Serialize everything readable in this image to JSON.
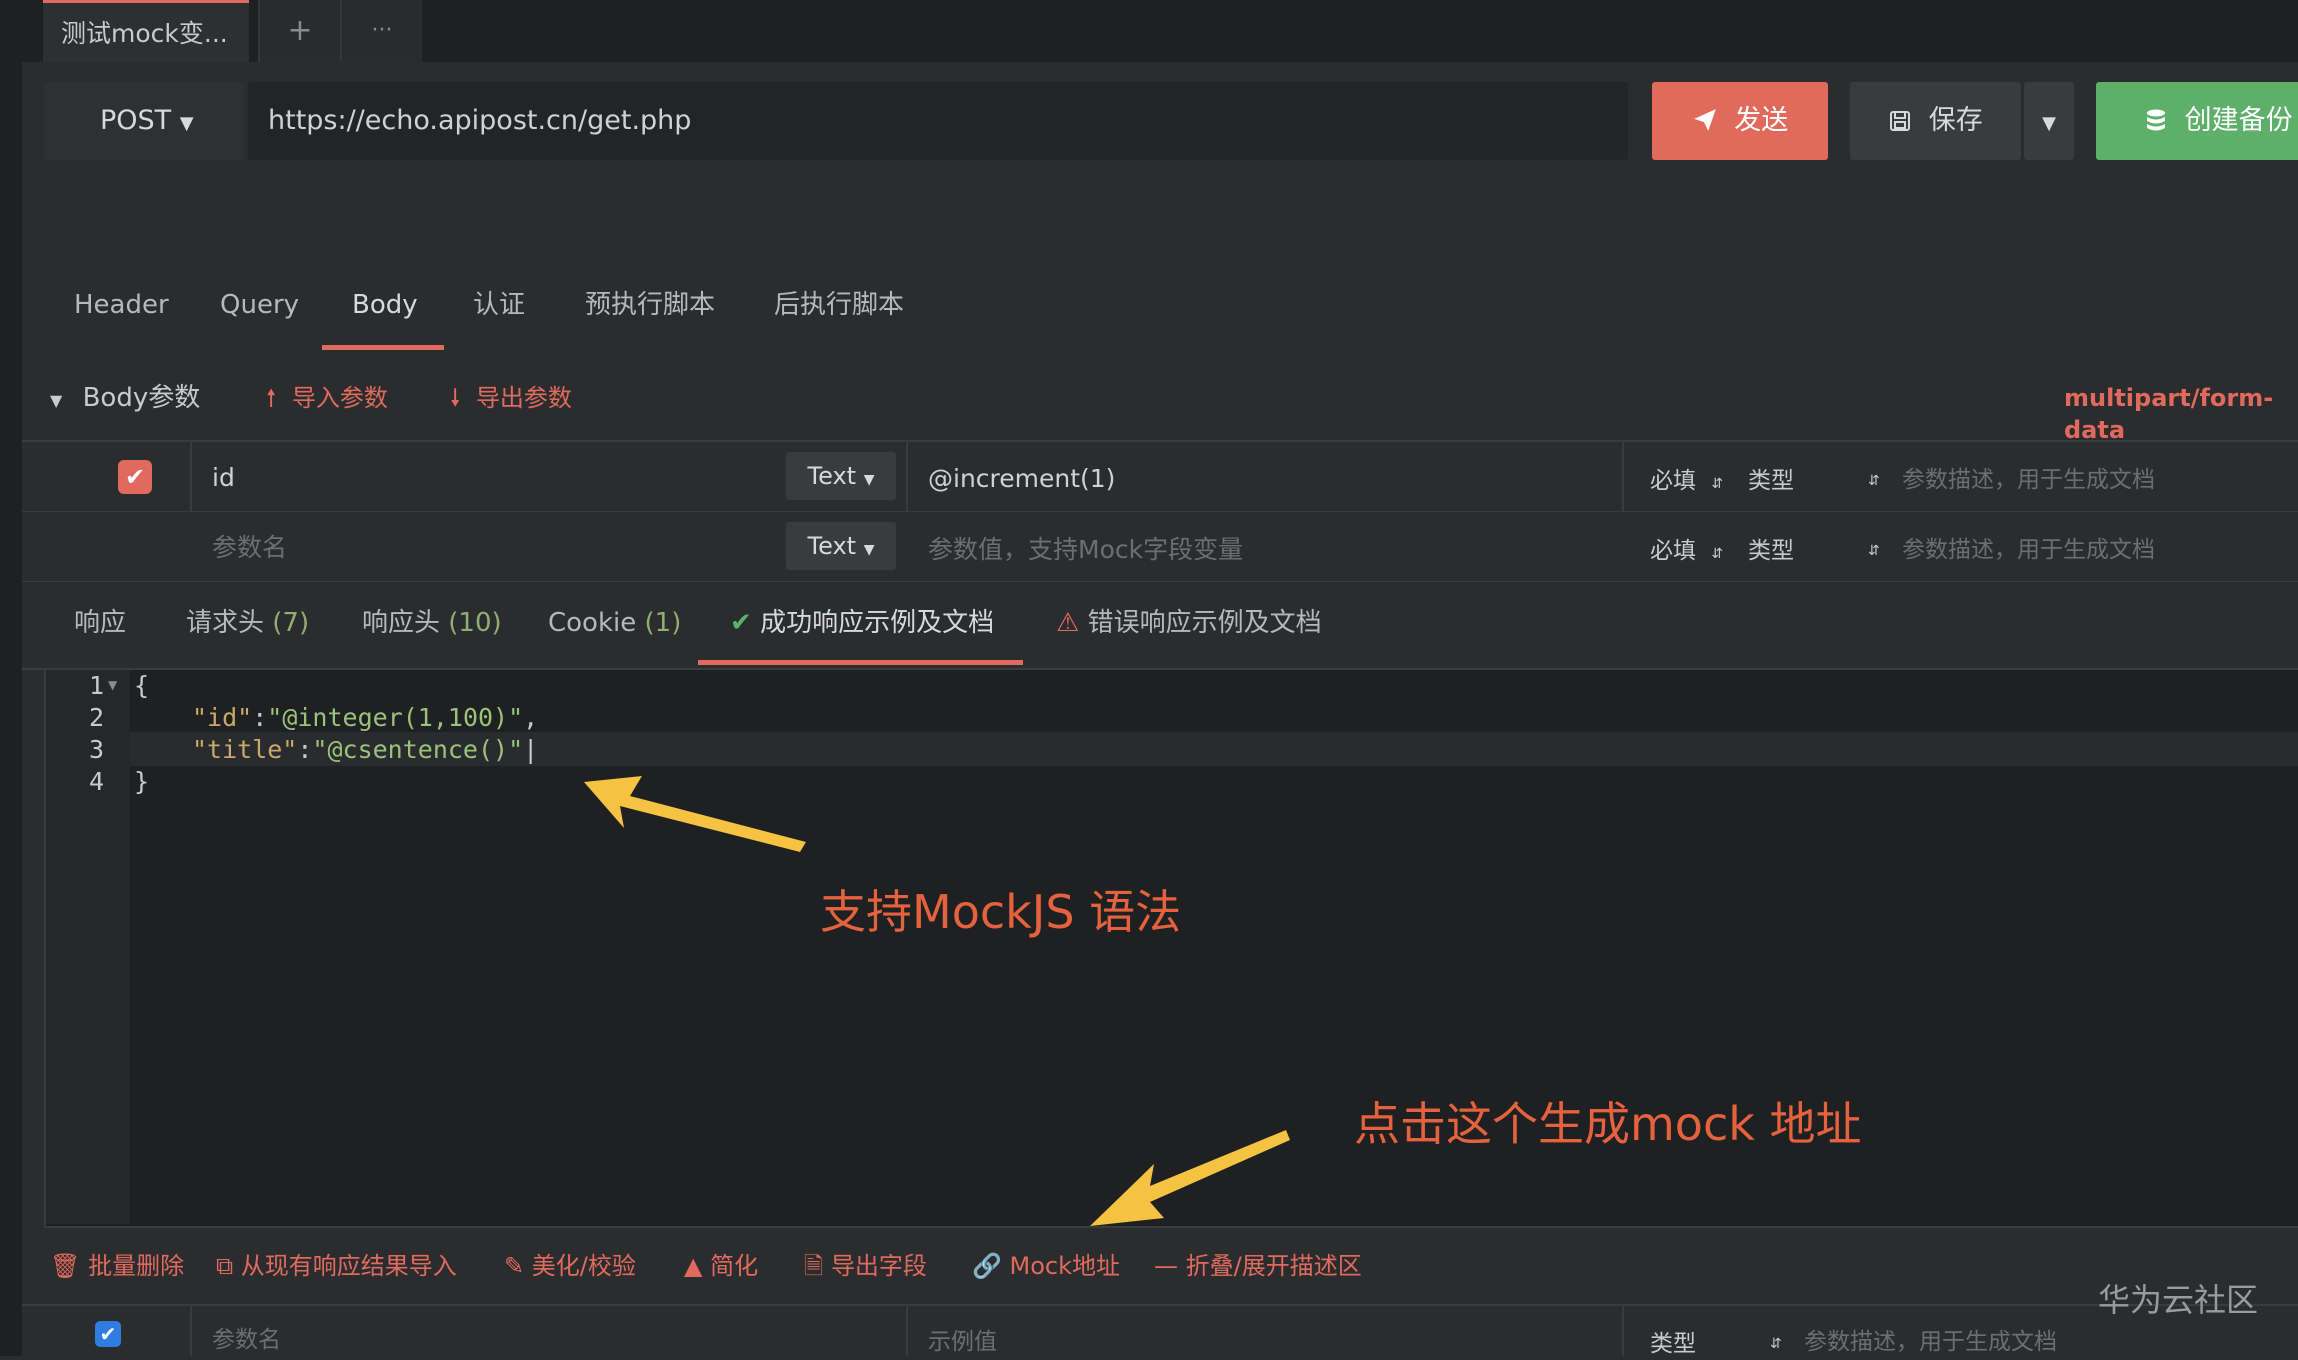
{
  "tab": {
    "title": "测试mock变...",
    "add_label": "+",
    "more_label": "···"
  },
  "request": {
    "method": "POST",
    "url": "https://echo.apipost.cn/get.php",
    "send_label": "发送",
    "save_label": "保存",
    "backup_label": "创建备份"
  },
  "param_tabs": [
    "Header",
    "Query",
    "Body",
    "认证",
    "预执行脚本",
    "后执行脚本"
  ],
  "active_param_tab": "Body",
  "body_bar": {
    "title": "Body参数",
    "import_label": "导入参数",
    "export_label": "导出参数",
    "content_type": "multipart/form-data"
  },
  "params": [
    {
      "checked": true,
      "name": "id",
      "type": "Text",
      "value": "@increment(1)",
      "required": "必填",
      "datatype": "类型",
      "desc_placeholder": "参数描述，用于生成文档"
    },
    {
      "checked": false,
      "name_placeholder": "参数名",
      "type": "Text",
      "value_placeholder": "参数值，支持Mock字段变量",
      "required": "必填",
      "datatype": "类型",
      "desc_placeholder": "参数描述，用于生成文档"
    }
  ],
  "response_tabs": [
    {
      "label": "响应"
    },
    {
      "label": "请求头",
      "count": "(7)"
    },
    {
      "label": "响应头",
      "count": "(10)"
    },
    {
      "label": "Cookie",
      "count": "(1)"
    },
    {
      "label": "成功响应示例及文档"
    },
    {
      "label": "错误响应示例及文档"
    }
  ],
  "editor": {
    "line_numbers": [
      "1",
      "2",
      "3",
      "4"
    ],
    "lines": {
      "l1": "{",
      "l2_key": "\"id\"",
      "l2_sep": ":",
      "l2_val": "\"@integer(1,100)\"",
      "l2_end": ",",
      "l3_key": "\"title\"",
      "l3_sep": ":",
      "l3_val": "\"@csentence()\"",
      "l4": "}"
    }
  },
  "annotations": {
    "mockjs": "支持MockJS 语法",
    "mock_url": "点击这个生成mock 地址"
  },
  "toolbar": {
    "batch_delete": "批量删除",
    "import_from_response": "从现有响应结果导入",
    "beautify": "美化/校验",
    "simplify": "简化",
    "export_fields": "导出字段",
    "mock_url": "Mock地址",
    "toggle_desc": "折叠/展开描述区"
  },
  "bottom_row": {
    "name_placeholder": "参数名",
    "value_placeholder": "示例值",
    "datatype": "类型",
    "desc_placeholder": "参数描述，用于生成文档"
  },
  "watermark": "华为云社区",
  "colors": {
    "accent": "#e06a5e",
    "success": "#5eaf6a",
    "annotation": "#e4623d",
    "arrow": "#f5c242"
  }
}
